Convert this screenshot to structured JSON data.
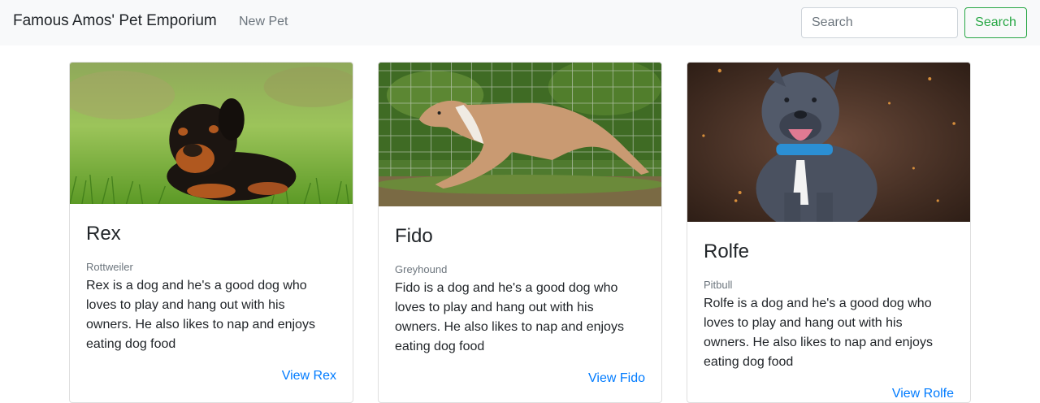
{
  "navbar": {
    "brand": "Famous Amos' Pet Emporium",
    "new_pet_link": "New Pet",
    "search_placeholder": "Search",
    "search_button": "Search"
  },
  "pets": [
    {
      "name": "Rex",
      "breed": "Rottweiler",
      "description": "Rex is a dog and he's a good dog who loves to play and hang out with his owners. He also likes to nap and enjoys eating dog food",
      "link": "View Rex"
    },
    {
      "name": "Fido",
      "breed": "Greyhound",
      "description": "Fido is a dog and he's a good dog who loves to play and hang out with his owners. He also likes to nap and enjoys eating dog food",
      "link": "View Fido"
    },
    {
      "name": "Rolfe",
      "breed": "Pitbull",
      "description": "Rolfe is a dog and he's a good dog who loves to play and hang out with his owners. He also likes to nap and enjoys eating dog food",
      "link": "View Rolfe"
    }
  ],
  "colors": {
    "navbar_bg": "#f8f9fa",
    "success": "#28a745",
    "link": "#007bff",
    "muted": "#6c757d"
  }
}
